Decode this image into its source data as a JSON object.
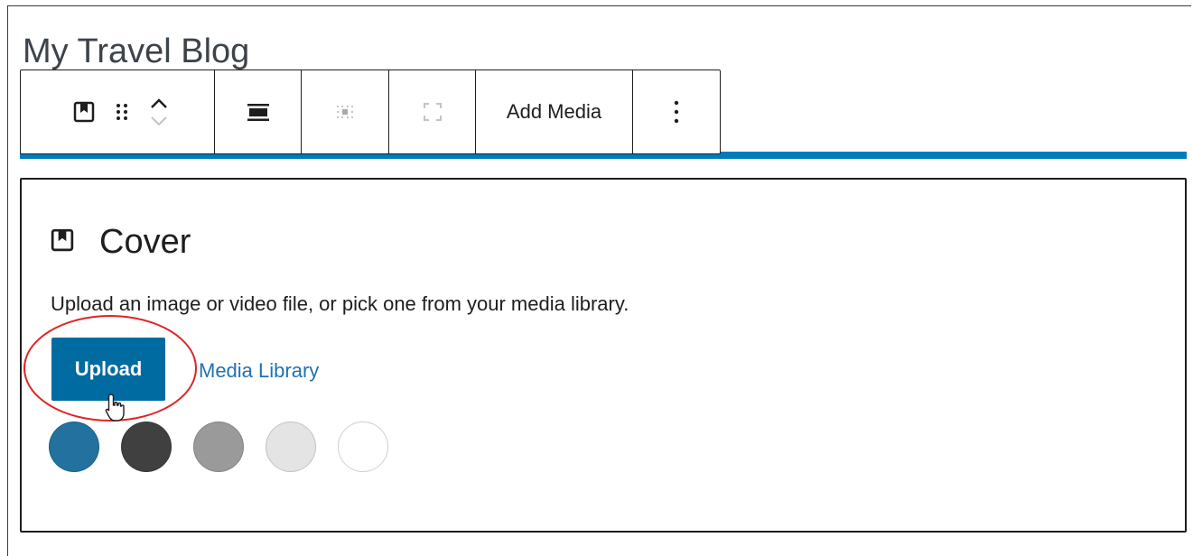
{
  "post": {
    "title": "My Travel Blog"
  },
  "toolbar": {
    "block_icon": "cover-block-icon",
    "drag_icon": "drag-handle-icon",
    "move_up_icon": "chevron-up-icon",
    "move_down_icon": "chevron-down-icon",
    "align_icon": "align-wide-icon",
    "position_icon": "content-position-icon",
    "fullheight_icon": "full-height-icon",
    "add_media_label": "Add Media",
    "more_icon": "more-vertical-icon"
  },
  "cover": {
    "title": "Cover",
    "instructions": "Upload an image or video file, or pick one from your media library.",
    "upload_label": "Upload",
    "media_library_label": "Media Library",
    "swatches": [
      {
        "name": "swatch-blue",
        "color": "#22719e"
      },
      {
        "name": "swatch-dark-gray",
        "color": "#404040"
      },
      {
        "name": "swatch-gray",
        "color": "#9a9a9a"
      },
      {
        "name": "swatch-light-gray",
        "color": "#e4e4e4"
      },
      {
        "name": "swatch-white",
        "color": "#ffffff"
      }
    ]
  },
  "colors": {
    "accent": "#007cba",
    "upload_button": "#006ba1",
    "link": "#2271b1",
    "annotation": "#e02424"
  }
}
